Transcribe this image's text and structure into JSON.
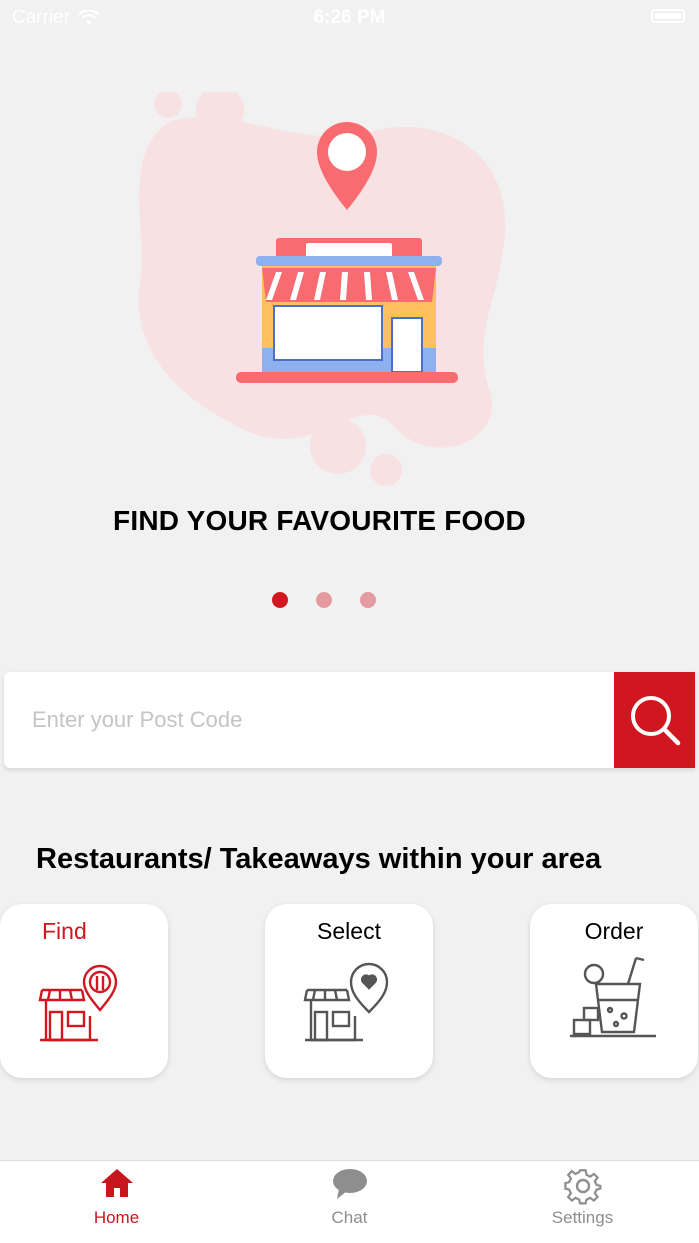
{
  "status_bar": {
    "carrier": "Carrier",
    "time": "6:26 PM"
  },
  "onboarding": {
    "headline": "FIND YOUR FAVOURITE FOOD",
    "page_count": 3,
    "active_page": 1
  },
  "search": {
    "placeholder": "Enter your Post Code",
    "value": ""
  },
  "section": {
    "title": "Restaurants/ Takeaways within your area"
  },
  "cards": [
    {
      "label": "Find",
      "icon": "restaurant-location-icon"
    },
    {
      "label": "Select",
      "icon": "favorite-shop-icon"
    },
    {
      "label": "Order",
      "icon": "drink-order-icon"
    }
  ],
  "tabs": [
    {
      "label": "Home",
      "icon": "home-icon",
      "active": true
    },
    {
      "label": "Chat",
      "icon": "chat-icon",
      "active": false
    },
    {
      "label": "Settings",
      "icon": "gear-icon",
      "active": false
    }
  ],
  "colors": {
    "accent": "#d0161f",
    "background": "#f1f1f1",
    "inactive": "#8e8e8e"
  }
}
